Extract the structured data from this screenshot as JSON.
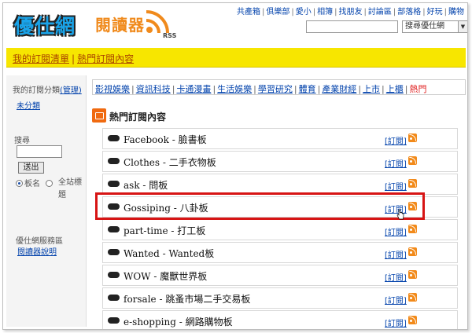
{
  "header": {
    "logo_text": "優仕網",
    "reader_title": "閱讀器",
    "rss_label": "RSS",
    "top_links": [
      "共產箱",
      "俱樂部",
      "愛小",
      "相簿",
      "找朋友",
      "討論區",
      "部落格",
      "好玩",
      "購物"
    ],
    "search_select": "搜尋優仕網"
  },
  "nav": {
    "my_subscriptions": "我的訂閱清單",
    "separator": "|",
    "hot_subscriptions": "熱門訂閱內容"
  },
  "sidebar": {
    "category_label": "我的訂閱分類",
    "manage_link": "(管理)",
    "uncategorized": "未分類",
    "search_label": "搜尋",
    "submit_button": "送出",
    "radio_board_name": "板名",
    "radio_full_site": "全站標題",
    "service_label": "優仕網服務區",
    "reader_help": "閱讀器說明"
  },
  "categories": [
    {
      "label": "影視娛樂",
      "active": false
    },
    {
      "label": "資訊科技",
      "active": false
    },
    {
      "label": "卡通漫畫",
      "active": false
    },
    {
      "label": "生活娛樂",
      "active": false
    },
    {
      "label": "學習研究",
      "active": false
    },
    {
      "label": "體育",
      "active": false
    },
    {
      "label": "產業財經",
      "active": false
    },
    {
      "label": "上市",
      "active": false
    },
    {
      "label": "上櫃",
      "active": false
    },
    {
      "label": "熱門",
      "active": true
    }
  ],
  "hot_section": {
    "title": "熱門訂閱內容",
    "subscribe_label": "[訂閱]",
    "items": [
      {
        "name": "Facebook - 臉書板"
      },
      {
        "name": "Clothes - 二手衣物板"
      },
      {
        "name": "ask - 問板"
      },
      {
        "name": "Gossiping - 八卦板"
      },
      {
        "name": "part-time - 打工板"
      },
      {
        "name": "Wanted - Wanted板"
      },
      {
        "name": "WOW - 魔獸世界板"
      },
      {
        "name": "forsale - 跳蚤市場二手交易板"
      },
      {
        "name": "e-shopping - 網路購物板"
      }
    ]
  },
  "colors": {
    "accent_yellow": "#f7e600",
    "rss_orange": "#f28a1a",
    "highlight_red": "#d71414",
    "link_blue": "#0645ad"
  }
}
